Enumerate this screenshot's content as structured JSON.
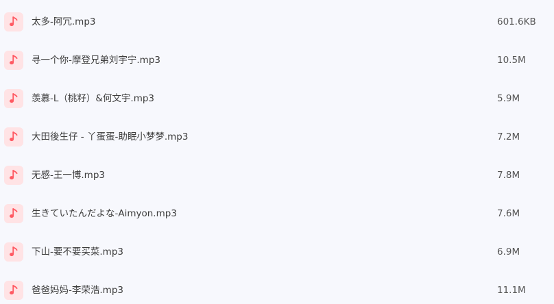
{
  "files": [
    {
      "name": "太多-阿冗.mp3",
      "size": "601.6KB",
      "icon": "music-note-icon"
    },
    {
      "name": "寻一个你-摩登兄弟刘宇宁.mp3",
      "size": "10.5M",
      "icon": "music-note-icon"
    },
    {
      "name": "羡慕-L（桃籽）&何文宇.mp3",
      "size": "5.9M",
      "icon": "music-note-icon"
    },
    {
      "name": "大田後生仔 - 丫蛋蛋-助眠小梦梦.mp3",
      "size": "7.2M",
      "icon": "music-note-icon"
    },
    {
      "name": "无感-王一博.mp3",
      "size": "7.8M",
      "icon": "music-note-icon"
    },
    {
      "name": "生きていたんだよな-Aimyon.mp3",
      "size": "7.6M",
      "icon": "music-note-icon"
    },
    {
      "name": "下山-要不要买菜.mp3",
      "size": "6.9M",
      "icon": "music-note-icon"
    },
    {
      "name": "爸爸妈妈-李荣浩.mp3",
      "size": "11.1M",
      "icon": "music-note-icon"
    }
  ],
  "colors": {
    "background": "#f7f8fd",
    "icon_bg": "#ffe3e5",
    "icon_fg": "#ff5a63",
    "text": "#3d3d3d"
  }
}
